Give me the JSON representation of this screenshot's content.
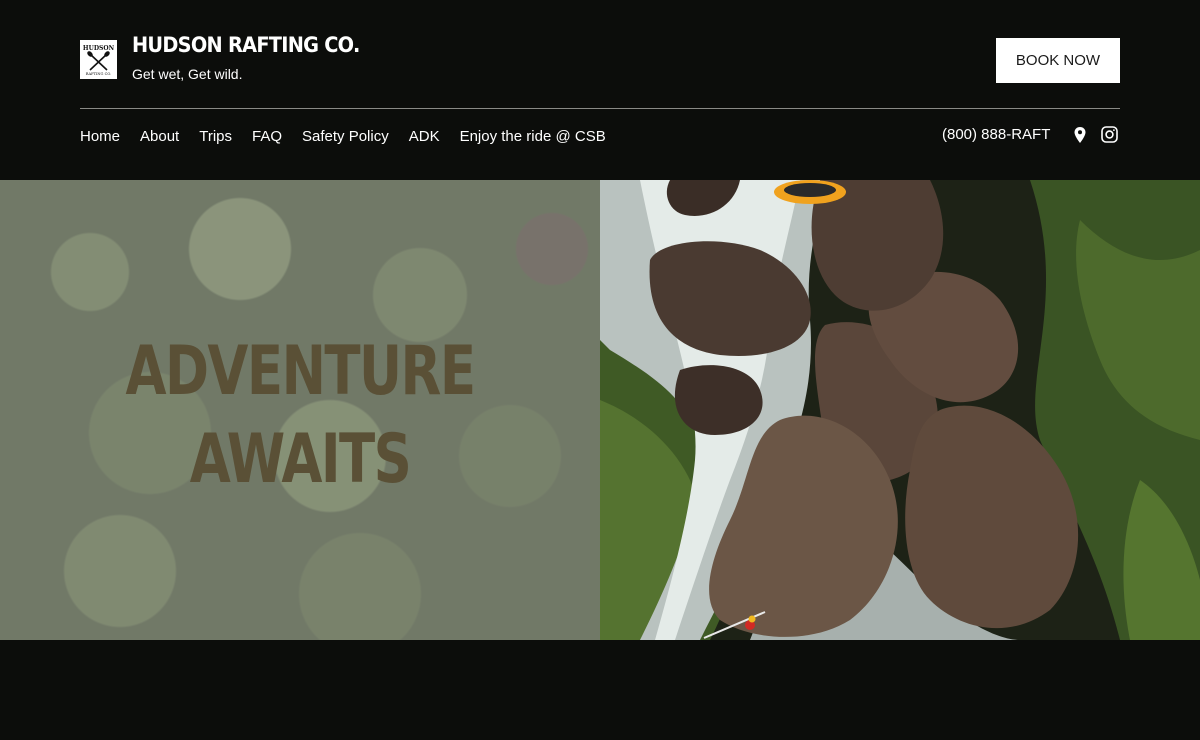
{
  "header": {
    "brand_title": "HUDSON RAFTING CO.",
    "tagline": "Get wet, Get wild.",
    "logo": {
      "icon": "crossed-paddles-icon",
      "top_text": "HUDSON",
      "bottom_text": "RAFTING CO."
    },
    "book_button": "BOOK NOW"
  },
  "nav": {
    "items": [
      {
        "label": "Home"
      },
      {
        "label": "About"
      },
      {
        "label": "Trips"
      },
      {
        "label": "FAQ"
      },
      {
        "label": "Safety Policy"
      },
      {
        "label": "ADK"
      },
      {
        "label": "Enjoy the ride @ CSB"
      }
    ],
    "phone": "(800) 888-RAFT",
    "social_icons": [
      "map-pin-icon",
      "instagram-icon"
    ]
  },
  "hero": {
    "headline_line1": "ADVENTURE",
    "headline_line2": "AWAITS"
  },
  "colors": {
    "background": "#0c0d0b",
    "text": "#ffffff",
    "button_bg": "#ffffff",
    "headline": "#5a5036"
  }
}
